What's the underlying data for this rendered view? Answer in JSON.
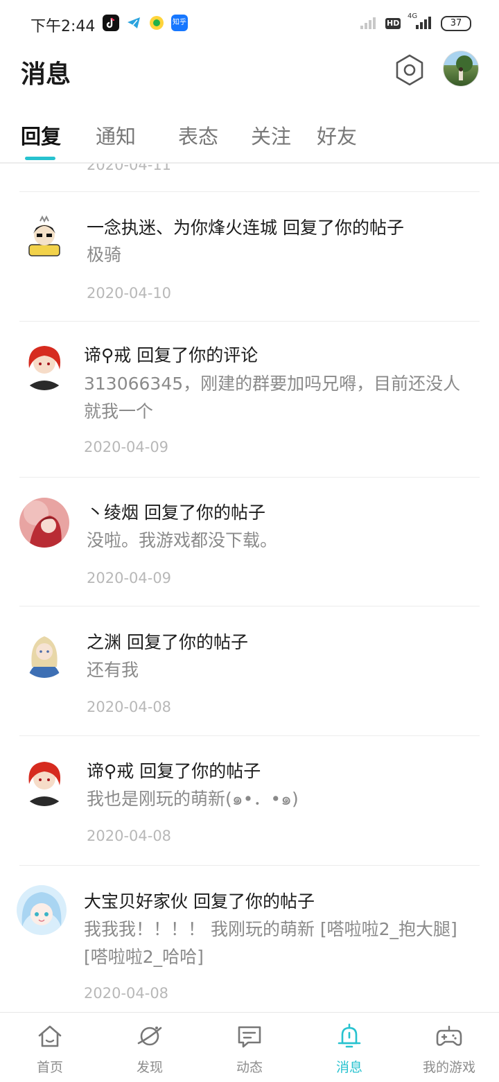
{
  "status_bar": {
    "time": "下午2:44",
    "zhihu_label": "知乎",
    "hd": "HD",
    "network": "4G",
    "battery": "37"
  },
  "header": {
    "title": "消息"
  },
  "tabs": [
    {
      "label": "回复",
      "active": true
    },
    {
      "label": "通知",
      "active": false
    },
    {
      "label": "表态",
      "active": false
    },
    {
      "label": "关注",
      "active": false
    },
    {
      "label": "好友",
      "active": false
    }
  ],
  "list": {
    "partial_date": "2020-04-11",
    "items": [
      {
        "title": "一念执迷、为你烽火连城 回复了你的帖子",
        "content": "极骑",
        "date": "2020-04-10"
      },
      {
        "title": "谛⚲戒 回复了你的评论",
        "content": "313066345，刚建的群要加吗兄嘚，目前还没人就我一个",
        "date": "2020-04-09"
      },
      {
        "title": "丶绫烟 回复了你的帖子",
        "content": "没啦。我游戏都没下载。",
        "date": "2020-04-09"
      },
      {
        "title": "之渊 回复了你的帖子",
        "content": "还有我",
        "date": "2020-04-08"
      },
      {
        "title": "谛⚲戒 回复了你的帖子",
        "content": "我也是刚玩的萌新(๑•．•๑)",
        "date": "2020-04-08"
      },
      {
        "title": "大宝贝好家伙 回复了你的帖子",
        "content": "我我我！！！！ 我刚玩的萌新 [嗒啦啦2_抱大腿][嗒啦啦2_哈哈]",
        "date": "2020-04-08"
      }
    ]
  },
  "bottom_nav": [
    {
      "label": "首页",
      "icon": "home-icon",
      "active": false
    },
    {
      "label": "发现",
      "icon": "planet-icon",
      "active": false
    },
    {
      "label": "动态",
      "icon": "feed-icon",
      "active": false
    },
    {
      "label": "消息",
      "icon": "bell-icon",
      "active": true
    },
    {
      "label": "我的游戏",
      "icon": "gamepad-icon",
      "active": false
    }
  ],
  "colors": {
    "accent": "#27c2cf"
  }
}
